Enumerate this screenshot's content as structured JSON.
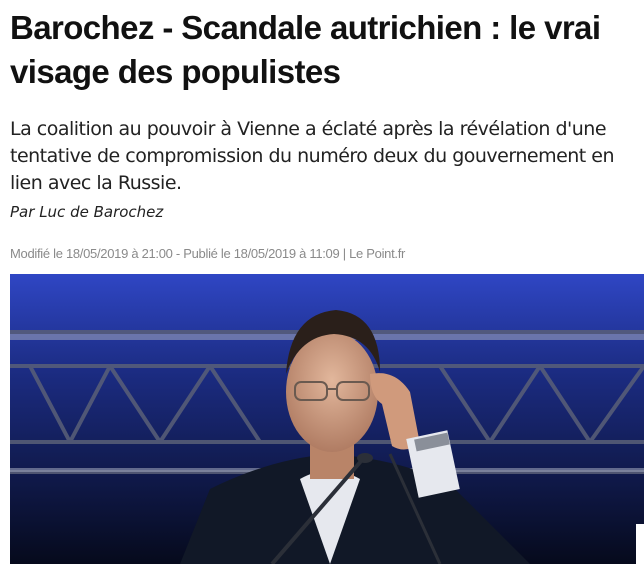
{
  "article": {
    "title": "Barochez - Scandale autrichien : le vrai visage des populistes",
    "lede": "La coalition au pouvoir à Vienne a éclaté après la révélation d'une tentative de compromission du numéro deux du gouvernement en lien avec la Russie.",
    "byline_prefix": "Par",
    "author": "Luc de Barochez",
    "meta": "Modifié le 18/05/2019 à 21:00 - Publié le 18/05/2019 à 11:09 | Le Point.fr"
  },
  "photo": {
    "stage_colors": {
      "top": "#2a3fb8",
      "mid": "#1a2a7a",
      "bottom": "#070b1e"
    }
  }
}
